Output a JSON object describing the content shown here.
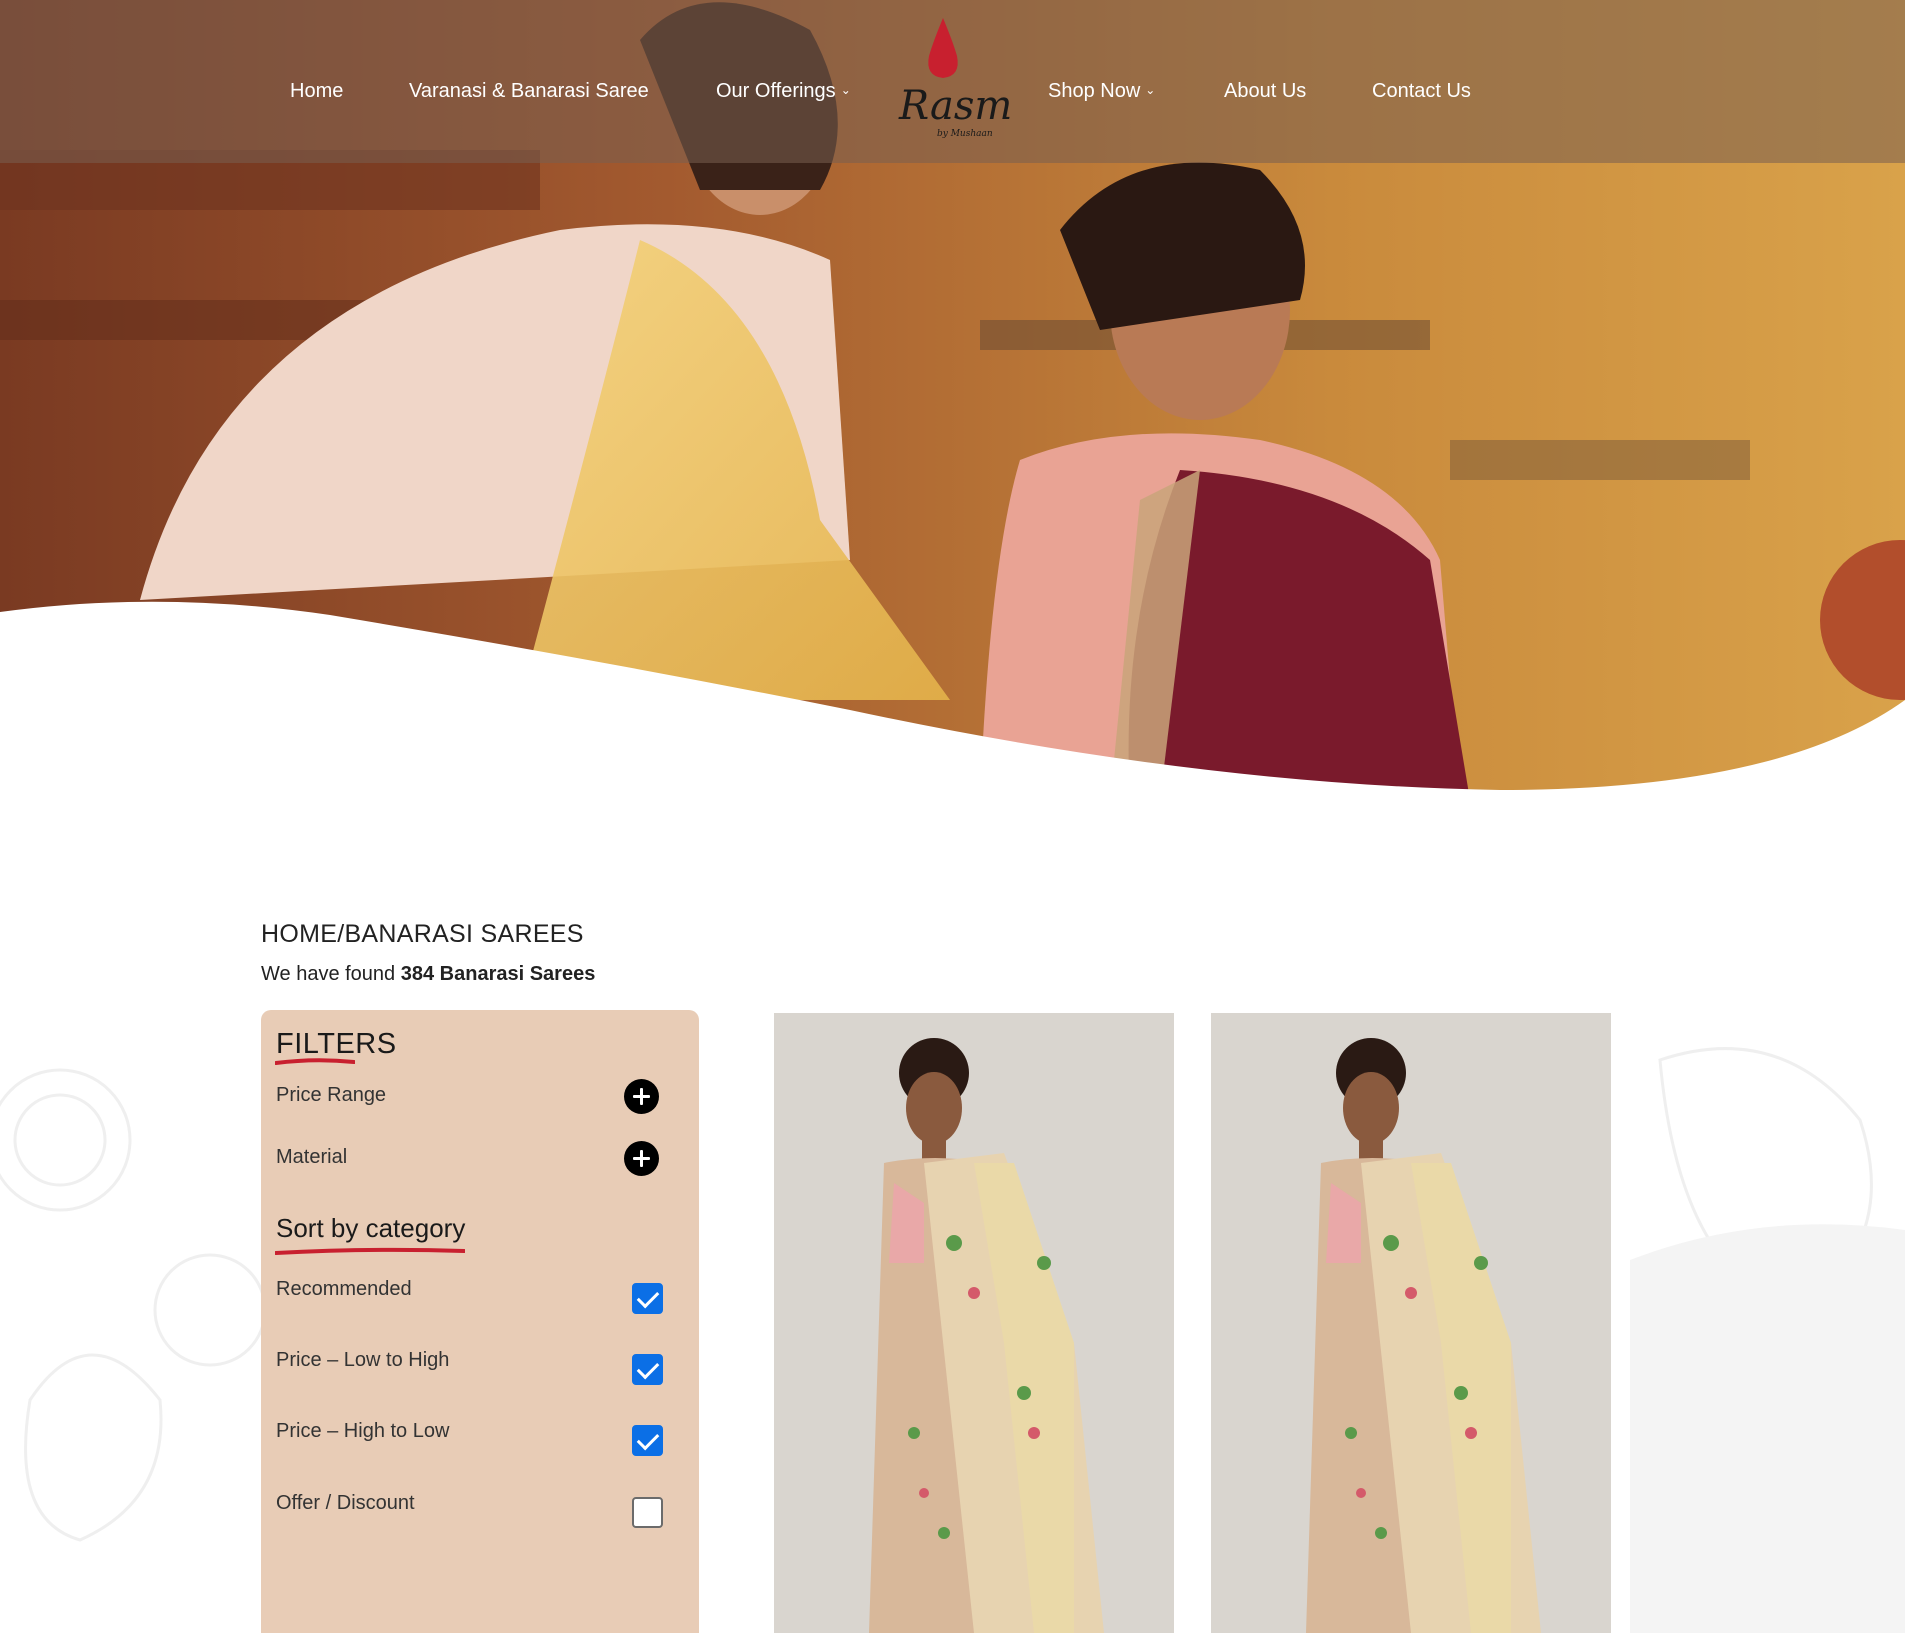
{
  "nav": {
    "home": "Home",
    "varanasi": "Varanasi & Banarasi Saree",
    "offerings": "Our Offerings",
    "shop": "Shop Now",
    "about": "About Us",
    "contact": "Contact Us"
  },
  "logo": {
    "main": "Rasm",
    "sub": "by Mushaan"
  },
  "breadcrumb": "HOME/BANARASI SAREES",
  "results": {
    "prefix": "We have found ",
    "count": "384 Banarasi Sarees"
  },
  "filters": {
    "title": "FILTERS",
    "price_range": "Price Range",
    "material": "Material",
    "sort_title": "Sort by category",
    "options": [
      {
        "label": "Recommended",
        "checked": true
      },
      {
        "label": "Price – Low to High",
        "checked": true
      },
      {
        "label": "Price – High to Low",
        "checked": true
      },
      {
        "label": "Offer / Discount",
        "checked": false
      }
    ]
  },
  "colors": {
    "accent_red": "#c8202f",
    "filter_panel": "#e8ccb6",
    "checkbox_blue": "#0b6fe6"
  }
}
